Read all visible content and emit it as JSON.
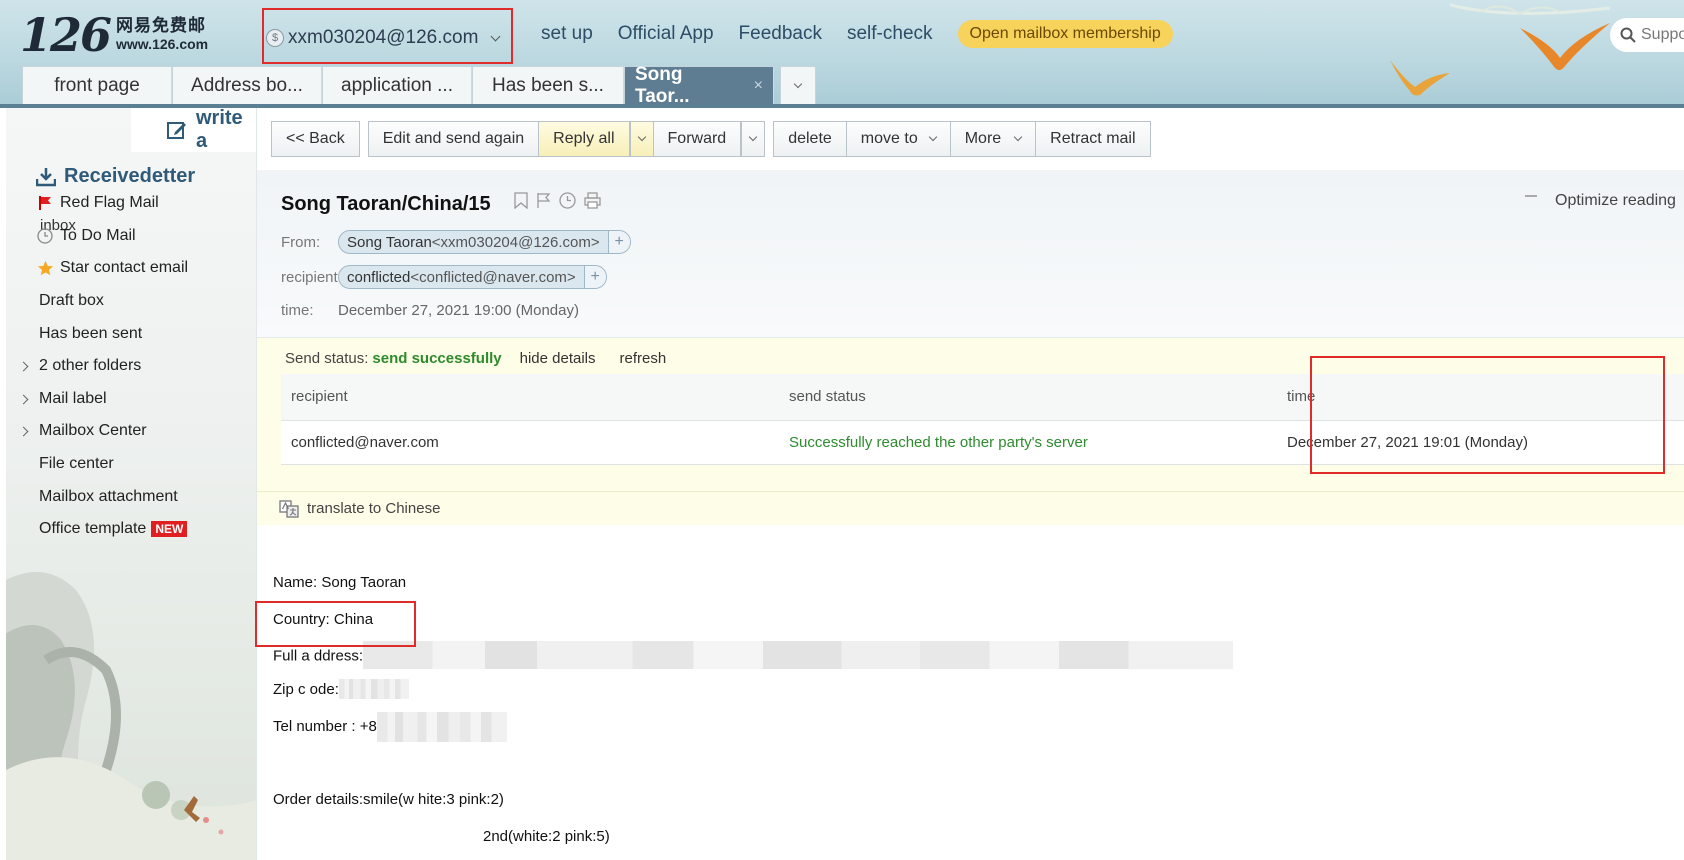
{
  "header": {
    "logo_num": "126",
    "logo_cn": "网易免费邮",
    "logo_url": "www.126.com",
    "account": "xxm030204@126.com",
    "nav": [
      "set up",
      "Official App",
      "Feedback",
      "self-check"
    ],
    "membership": "Open mailbox membership",
    "search_placeholder": "Suppo"
  },
  "tabs": [
    {
      "label": "front page",
      "active": false
    },
    {
      "label": "Address bo...",
      "active": false
    },
    {
      "label": "application ...",
      "active": false
    },
    {
      "label": "Has been s...",
      "active": false
    },
    {
      "label": "Song Taor...",
      "active": true
    }
  ],
  "tab_close": "×",
  "sidebar": {
    "write": "write a",
    "receive": "Receivedetter",
    "inbox": "inbox",
    "items": [
      {
        "label": "Red Flag Mail",
        "icon": "flag-icon"
      },
      {
        "label": "To Do Mail",
        "icon": "clock-icon"
      },
      {
        "label": "Star contact email",
        "icon": "star-icon"
      },
      {
        "label": "Draft box",
        "icon": ""
      },
      {
        "label": "Has been sent",
        "icon": ""
      },
      {
        "label": "2 other folders",
        "icon": "chevron"
      },
      {
        "label": "Mail label",
        "icon": "chevron"
      },
      {
        "label": "Mailbox Center",
        "icon": "chevron"
      },
      {
        "label": "File center",
        "icon": ""
      },
      {
        "label": "Mailbox attachment",
        "icon": ""
      },
      {
        "label": "Office template",
        "icon": ""
      }
    ],
    "new_badge": "NEW"
  },
  "toolbar": {
    "back": "<< Back",
    "edit_again": "Edit and send again",
    "reply_all": "Reply all",
    "forward": "Forward",
    "delete": "delete",
    "move_to": "move to",
    "more": "More",
    "retract": "Retract mail"
  },
  "mail": {
    "subject": "Song Taoran/China/15",
    "optimize": "Optimize reading",
    "from_label": "From:",
    "from_name": "Song Taoran",
    "from_addr": "<xxm030204@126.com>",
    "to_label": "recipient",
    "to_name": "conflicted",
    "to_addr": "<conflicted@naver.com>",
    "time_label": "time:",
    "time_value": "December 27, 2021 19:00 (Monday)",
    "plus": "+"
  },
  "status": {
    "label": "Send status:",
    "value": "send successfully",
    "hide": "hide details",
    "refresh": "refresh",
    "columns": [
      "recipient",
      "send status",
      "time"
    ],
    "rows": [
      [
        "conflicted@naver.com",
        "Successfully reached the other party's server",
        "December 27, 2021 19:01 (Monday)"
      ]
    ],
    "translate": "translate to Chinese"
  },
  "body": {
    "name": "Name: Song Taoran",
    "country": "Country: China",
    "address": "Full a ddress:",
    "zip": "Zip c ode:",
    "tel": "Tel number : +8",
    "order": "Order details:smile(w hite:3 pink:2)",
    "order2": "2nd(white:2 pink:5)"
  },
  "colors": {
    "accent": "#5e7d92",
    "success": "#2e8b2e",
    "highlight": "#e02b2b"
  }
}
